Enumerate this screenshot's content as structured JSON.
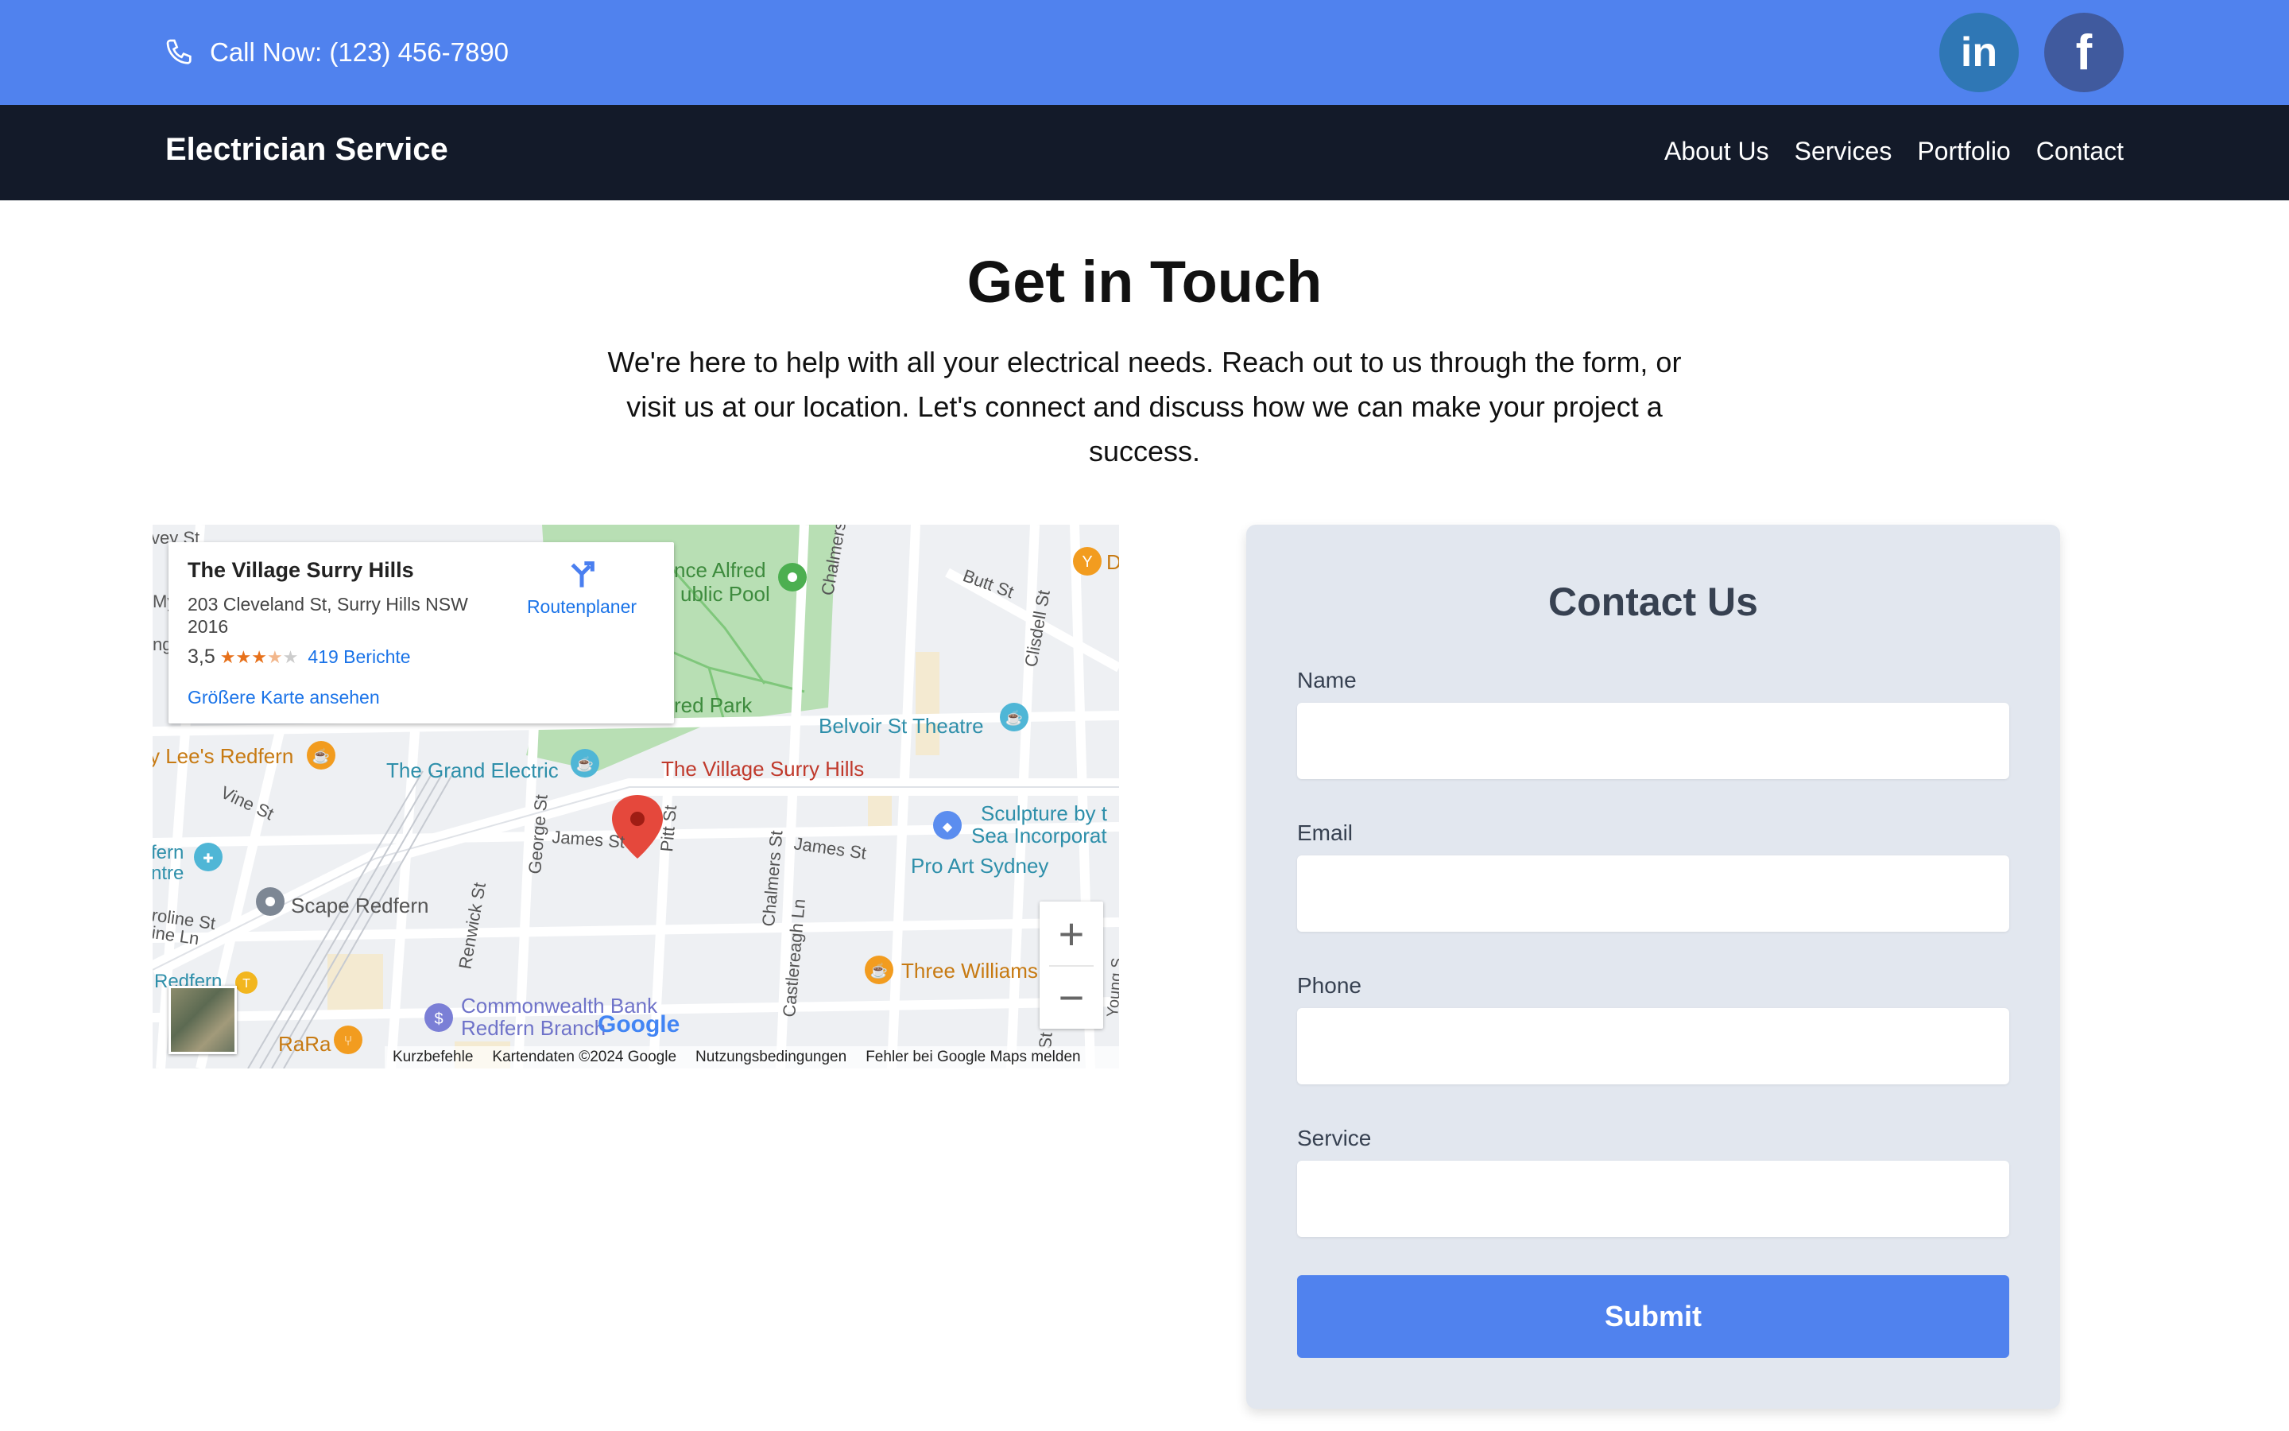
{
  "topbar": {
    "call_text": "Call Now: (123) 456-7890",
    "bg_color": "#5082ee",
    "social": {
      "linkedin_label": "in",
      "facebook_label": "f",
      "linkedin_color": "#2f77b5",
      "facebook_color": "#405a9e"
    }
  },
  "navbar": {
    "brand": "Electrician Service",
    "bg_color": "#131a29",
    "links": [
      "About Us",
      "Services",
      "Portfolio",
      "Contact"
    ]
  },
  "hero": {
    "title": "Get in Touch",
    "subtitle": "We're here to help with all your electrical needs. Reach out to us through the form, or visit us at our location. Let's connect and discuss how we can make your project a success."
  },
  "map": {
    "place_name": "The Village Surry Hills",
    "address": "203 Cleveland St, Surry Hills NSW 2016",
    "rating": "3,5",
    "rating_value": 3.5,
    "reviews": "419 Berichte",
    "larger_map": "Größere Karte ansehen",
    "directions": "Routenplaner",
    "zoom_in": "+",
    "zoom_out": "−",
    "google_logo": "Google",
    "footer": [
      "Kurzbefehle",
      "Kartendaten ©2024 Google",
      "Nutzungsbedingungen",
      "Fehler bei Google Maps melden"
    ],
    "labels": {
      "pool": "nce Alfred",
      "pool2": "ublic Pool",
      "park": "red Park",
      "chalmers_top": "Chalmers",
      "butt": "Butt St",
      "clisdell": "Clisdell St",
      "belvoir": "Belvoir St Theatre",
      "lees": "y Lee's Redfern",
      "grand": "The Grand Electric",
      "village": "The Village Surry Hills",
      "vine": "Vine St",
      "james1": "James St",
      "james2": "James St",
      "pitt": "Pitt St",
      "george": "George St",
      "chalmers": "Chalmers St",
      "castlereagh": "Castlereagh Ln",
      "sculpture": "Sculpture by t",
      "sea": "Sea Incorporat",
      "proart": "Pro Art Sydney",
      "fern": "fern",
      "ntre": "ntre",
      "scape": "Scape Redfern",
      "roline": "roline St",
      "ineln": "ine Ln",
      "renwick": "Renwick St",
      "redfern": "Redfern",
      "bank1": "Commonwealth Bank",
      "bank2": "Redfern Branch",
      "rara": "RaRa",
      "three": "Three Williams",
      "my": "My",
      "ng": "ng",
      "vey": "vey St",
      "d": "D",
      "st": "St",
      "young": "Young S"
    }
  },
  "form": {
    "title": "Contact Us",
    "name_label": "Name",
    "email_label": "Email",
    "phone_label": "Phone",
    "service_label": "Service",
    "name_value": "",
    "email_value": "",
    "phone_value": "",
    "service_value": "",
    "submit_label": "Submit",
    "card_color": "#e2e7ef",
    "button_color": "#5082ee"
  }
}
